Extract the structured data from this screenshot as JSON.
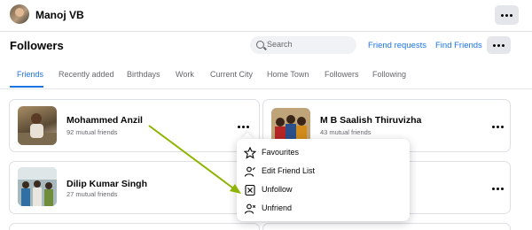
{
  "topbar": {
    "profile_name": "Manoj VB"
  },
  "header": {
    "title": "Followers",
    "search_placeholder": "Search",
    "friend_requests": "Friend requests",
    "find_friends": "Find Friends"
  },
  "tabs": [
    "Friends",
    "Recently added",
    "Birthdays",
    "Work",
    "Current City",
    "Home Town",
    "Followers",
    "Following"
  ],
  "friends": [
    {
      "name": "Mohammed Anzil",
      "mutual": "92 mutual friends"
    },
    {
      "name": "M B Saalish Thiruvizha",
      "mutual": "43 mutual friends"
    },
    {
      "name": "Dilip Kumar Singh",
      "mutual": "27 mutual friends"
    }
  ],
  "menu": {
    "items": [
      {
        "label": "Favourites",
        "icon": "star-icon"
      },
      {
        "label": "Edit Friend List",
        "icon": "edit-list-icon"
      },
      {
        "label": "Unfollow",
        "icon": "unfollow-icon"
      },
      {
        "label": "Unfriend",
        "icon": "unfriend-icon"
      }
    ]
  },
  "colors": {
    "accent": "#1b74e4",
    "annotation_arrow": "#8db400"
  }
}
